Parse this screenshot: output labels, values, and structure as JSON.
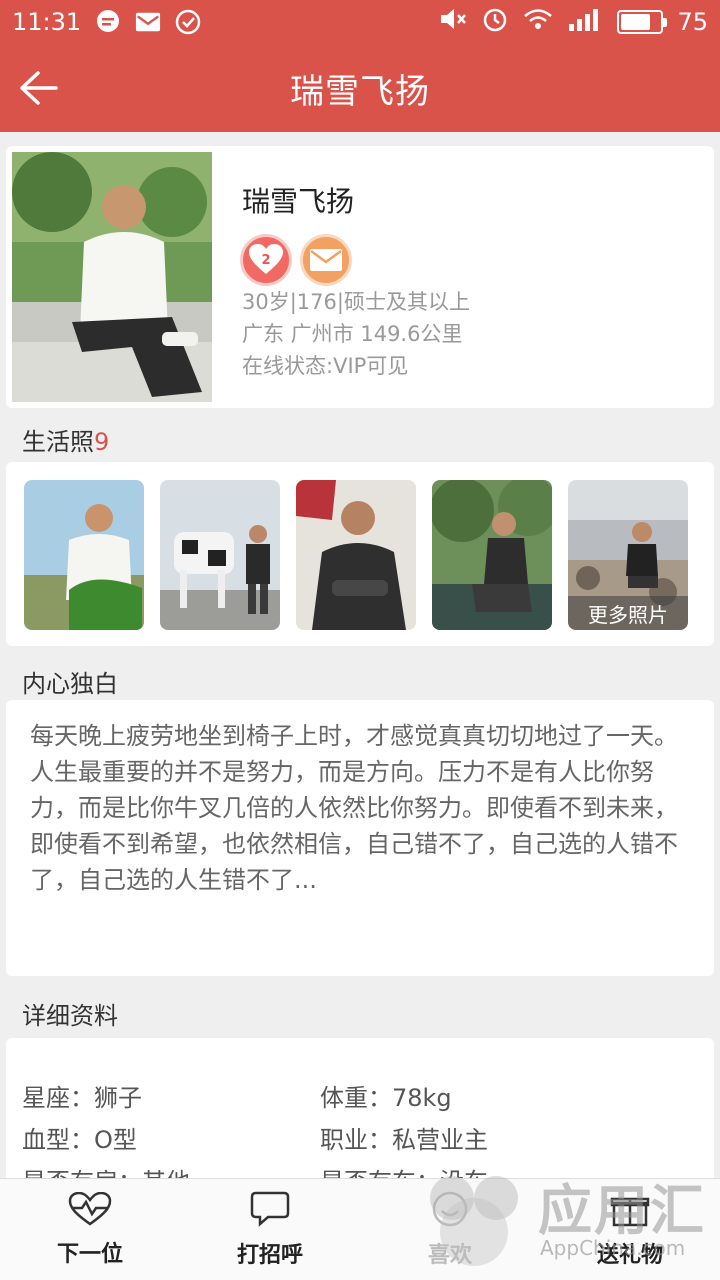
{
  "status_bar": {
    "time": "11:31",
    "battery": "75",
    "icons": [
      "chat-icon",
      "mail-icon",
      "check-icon",
      "mute-icon",
      "alarm-icon",
      "wifi-icon",
      "signal-4g-icon"
    ]
  },
  "header": {
    "title": "瑞雪飞扬",
    "back_icon": "back-arrow-icon"
  },
  "profile": {
    "name": "瑞雪飞扬",
    "heart_count": "2",
    "line1": "30岁|176|硕士及其以上",
    "line2": "广东 广州市 149.6公里",
    "line3": "在线状态:VIP可见"
  },
  "photos": {
    "title": "生活照",
    "count": "9",
    "more_label": "更多照片"
  },
  "monologue": {
    "title": "内心独白",
    "text": "每天晚上疲劳地坐到椅子上时，才感觉真真切切地过了一天。人生最重要的并不是努力，而是方向。压力不是有人比你努力，而是比你牛叉几倍的人依然比你努力。即使看不到未来，即使看不到希望，也依然相信，自己错不了，自己选的人错不了，自己选的人生错不了..."
  },
  "details": {
    "title": "详细资料",
    "rows": [
      {
        "label": "星座：狮子",
        "label2": "体重：78kg"
      },
      {
        "label": "血型：O型",
        "label2": "职业：私营业主"
      },
      {
        "label": "是否有房：其他",
        "label2": "是否有车：没车"
      }
    ]
  },
  "bottom_tabs": [
    {
      "label": "下一位",
      "icon": "heartbeat-icon"
    },
    {
      "label": "打招呼",
      "icon": "chat-bubble-icon"
    },
    {
      "label": "喜欢",
      "icon": "smile-icon"
    },
    {
      "label": "送礼物",
      "icon": "gift-icon"
    }
  ],
  "watermark": {
    "text": "应用汇",
    "sub": "AppChina.com"
  },
  "colors": {
    "primary": "#d9534a",
    "accent": "#d9534a",
    "muted": "#999999"
  }
}
